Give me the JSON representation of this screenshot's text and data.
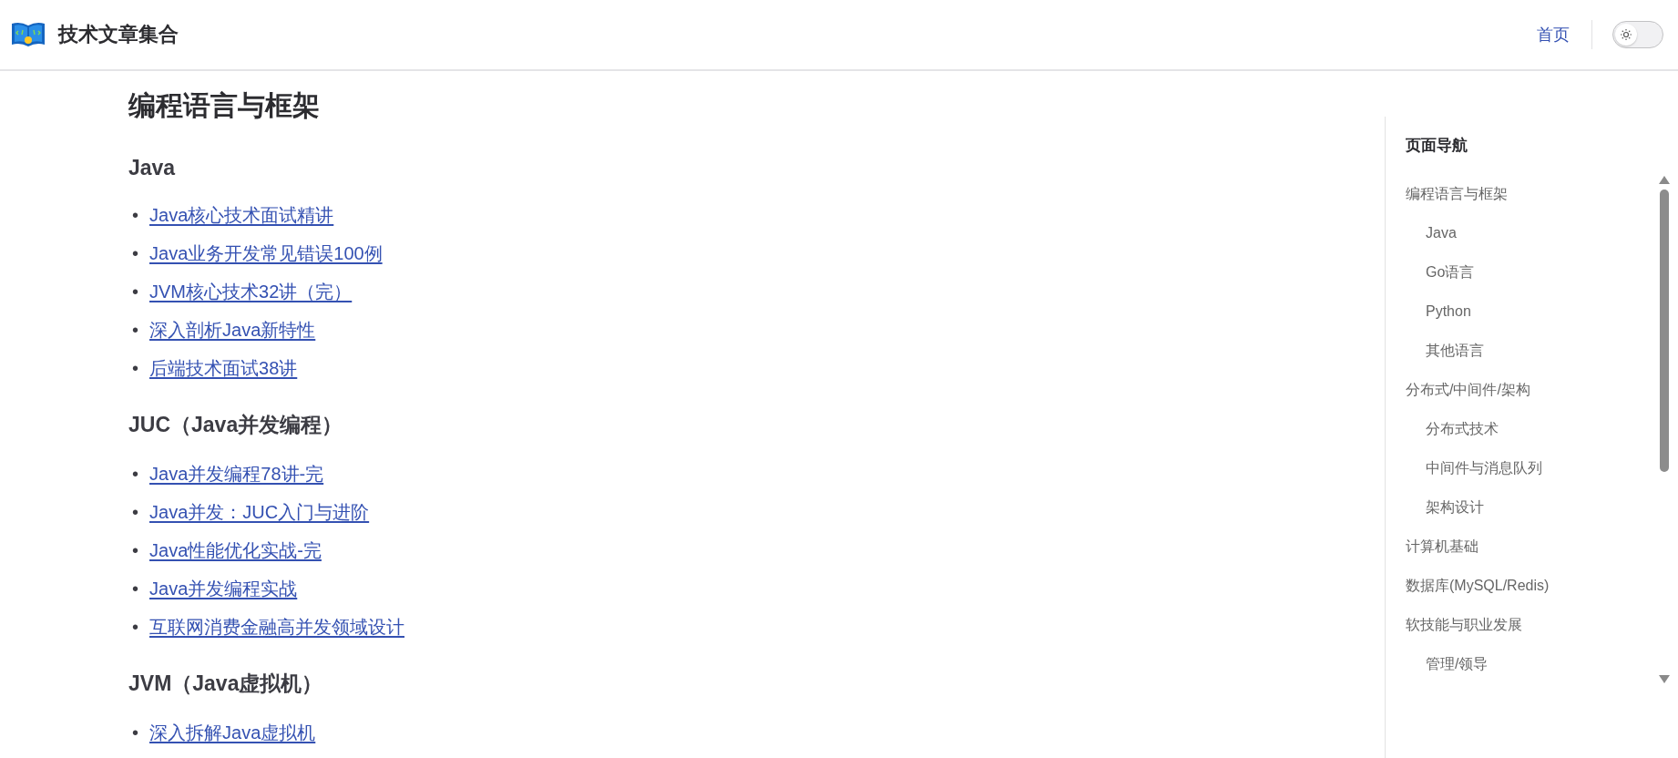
{
  "header": {
    "site_title": "技术文章集合",
    "nav": [
      {
        "label": "首页"
      }
    ],
    "theme_switch": {
      "on": false
    }
  },
  "article": {
    "title": "编程语言与框架",
    "bullet": "•",
    "sections": [
      {
        "heading": "Java",
        "links": [
          "Java核心技术面试精讲",
          "Java业务开发常见错误100例",
          "JVM核心技术32讲（完）",
          "深入剖析Java新特性",
          "后端技术面试38讲"
        ]
      },
      {
        "heading": "JUC（Java并发编程）",
        "links": [
          "Java并发编程78讲-完",
          "Java并发：JUC入门与进阶",
          "Java性能优化实战-完",
          "Java并发编程实战",
          "互联网消费金融高并发领域设计"
        ]
      },
      {
        "heading": "JVM（Java虚拟机）",
        "links": [
          "深入拆解Java虚拟机"
        ]
      }
    ]
  },
  "outline": {
    "title": "页面导航",
    "items": [
      {
        "label": "编程语言与框架",
        "children": [
          {
            "label": "Java"
          },
          {
            "label": "Go语言"
          },
          {
            "label": "Python"
          },
          {
            "label": "其他语言"
          }
        ]
      },
      {
        "label": "分布式/中间件/架构",
        "children": [
          {
            "label": "分布式技术"
          },
          {
            "label": "中间件与消息队列"
          },
          {
            "label": "架构设计"
          }
        ]
      },
      {
        "label": "计算机基础"
      },
      {
        "label": "数据库(MySQL/Redis)"
      },
      {
        "label": "软技能与职业发展",
        "children": [
          {
            "label": "管理/领导"
          }
        ]
      }
    ]
  }
}
